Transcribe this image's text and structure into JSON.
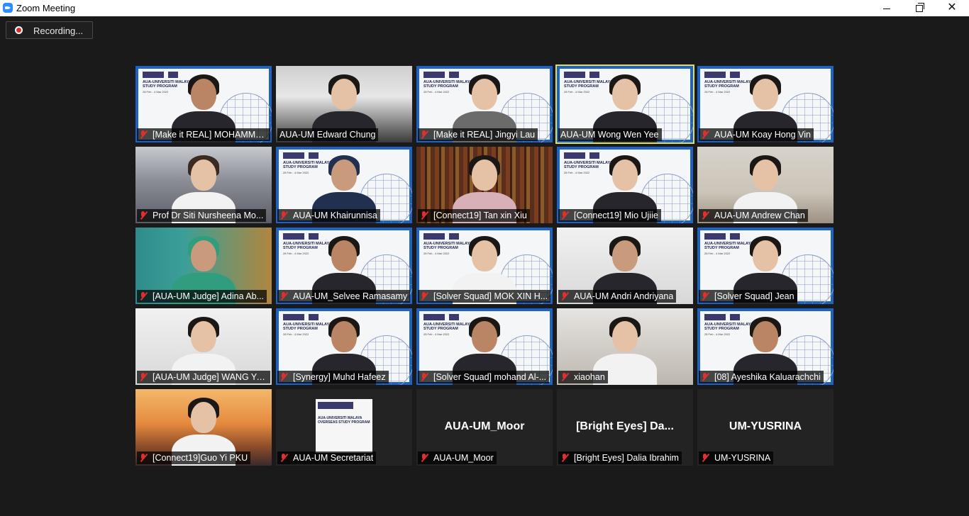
{
  "window": {
    "title": "Zoom Meeting",
    "icon": "zoom-icon"
  },
  "recording": {
    "label": "Recording..."
  },
  "slide": {
    "title": "AUA-UNIVERSITI MALAYA OVERSEAS STUDY PROGRAM",
    "date": "28 Feb - 4 Mar 2022"
  },
  "participants": [
    {
      "name": "[Make it REAL] MOHAMME...",
      "muted": true
    },
    {
      "name": "AUA-UM Edward Chung",
      "muted": false
    },
    {
      "name": "[Make it REAL] Jingyi Lau",
      "muted": true
    },
    {
      "name": "AUA-UM Wong Wen Yee",
      "muted": false,
      "active": true
    },
    {
      "name": "AUA-UM Koay Hong Vin",
      "muted": true
    },
    {
      "name": "Prof Dr Siti Nursheena Mo...",
      "muted": true
    },
    {
      "name": "AUA-UM Khairunnisa",
      "muted": true
    },
    {
      "name": "[Connect19] Tan xin Xiu",
      "muted": true
    },
    {
      "name": "[Connect19] Mio Ujiie",
      "muted": true
    },
    {
      "name": "AUA-UM Andrew Chan",
      "muted": true
    },
    {
      "name": "[AUA-UM Judge] Adina Ab...",
      "muted": true
    },
    {
      "name": "AUA-UM_Selvee Ramasamy",
      "muted": true
    },
    {
      "name": "[Solver Squad] MOK XIN H...",
      "muted": true
    },
    {
      "name": "AUA-UM Andri Andriyana",
      "muted": true
    },
    {
      "name": "[Solver Squad] Jean",
      "muted": true
    },
    {
      "name": "[AUA-UM Judge] WANG Ya...",
      "muted": true
    },
    {
      "name": "[Synergy]  Muhd Hafeez",
      "muted": true
    },
    {
      "name": "[Solver Squad] mohand Al-...",
      "muted": true
    },
    {
      "name": "xiaohan",
      "muted": true
    },
    {
      "name": "[08] Ayeshika Kaluarachchi",
      "muted": true
    },
    {
      "name": "[Connect19]Guo Yi PKU",
      "muted": true
    },
    {
      "name": "AUA-UM Secretariat",
      "muted": true
    },
    {
      "name": "AUA-UM_Moor",
      "muted": true,
      "center_label": "AUA-UM_Moor"
    },
    {
      "name": "[Bright Eyes] Dalia Ibrahim",
      "muted": true,
      "center_label": "[Bright Eyes]  Da..."
    },
    {
      "name": "UM-YUSRINA",
      "muted": true,
      "center_label": "UM-YUSRINA"
    }
  ]
}
